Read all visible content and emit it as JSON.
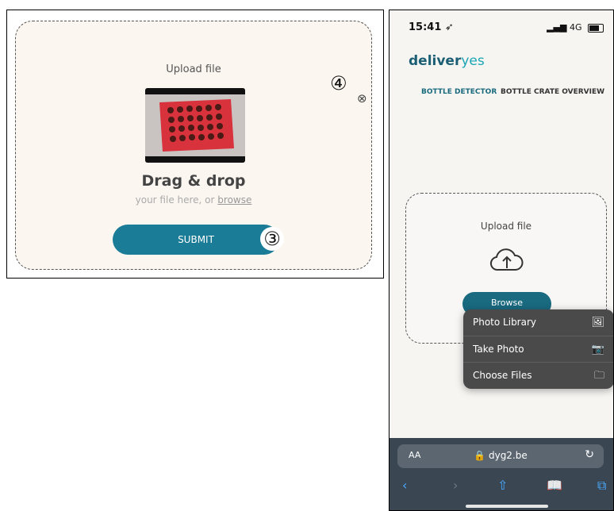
{
  "left": {
    "upload_title": "Upload file",
    "drag_title": "Drag & drop",
    "drag_sub_prefix": "your file here, or ",
    "browse_link": "browse",
    "submit_label": "SUBMIT",
    "step3": "③",
    "step4": "④",
    "close_icon": "⊗"
  },
  "phone": {
    "status_time": "15:41 ➶",
    "network": "4G",
    "logo_main": "deliver",
    "logo_accent": "yes",
    "nav": [
      "BOTTLE DETECTOR",
      "BOTTLE CRATE OVERVIEW"
    ],
    "upload_title": "Upload file",
    "browse_label": "Browse",
    "popup": [
      {
        "label": "Photo Library",
        "icon": "🖼"
      },
      {
        "label": "Take Photo",
        "icon": "📷"
      },
      {
        "label": "Choose Files",
        "icon": "🗀"
      }
    ],
    "url_aa": "AA",
    "url": "🔒 dyg2.be",
    "reload_icon": "↻",
    "toolbar": {
      "back": "‹",
      "forward": "›",
      "share": "⇧",
      "bookmarks": "📖",
      "tabs": "⧉"
    }
  }
}
